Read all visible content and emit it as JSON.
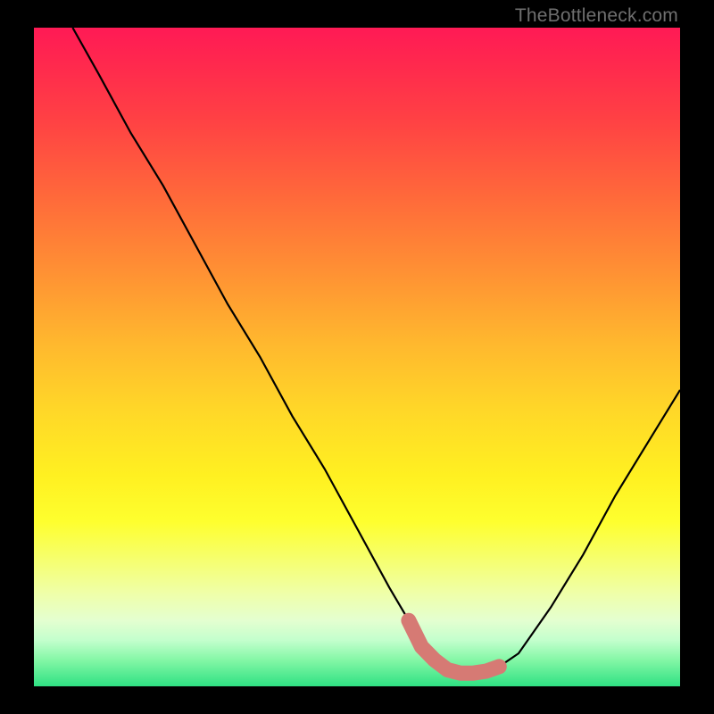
{
  "watermark": "TheBottleneck.com",
  "colors": {
    "curve": "#000000",
    "highlight": "#d67a74",
    "gradient_top": "#ff1a55",
    "gradient_bottom": "#2fe183"
  },
  "chart_data": {
    "type": "line",
    "title": "",
    "xlabel": "",
    "ylabel": "",
    "xlim": [
      0,
      100
    ],
    "ylim": [
      0,
      100
    ],
    "series": [
      {
        "name": "bottleneck-curve",
        "x": [
          6,
          10,
          15,
          20,
          25,
          30,
          35,
          40,
          45,
          50,
          55,
          58,
          60,
          62,
          64,
          66,
          68,
          70,
          72,
          75,
          80,
          85,
          90,
          95,
          100
        ],
        "y": [
          100,
          93,
          84,
          76,
          67,
          58,
          50,
          41,
          33,
          24,
          15,
          10,
          6,
          4,
          2.5,
          2,
          2,
          2.3,
          3,
          5,
          12,
          20,
          29,
          37,
          45
        ]
      }
    ],
    "annotations": [
      {
        "name": "optimal-range-highlight",
        "x": [
          58,
          60,
          62,
          64,
          66,
          68,
          70,
          72
        ],
        "y": [
          10,
          6,
          4,
          2.5,
          2,
          2,
          2.3,
          3
        ]
      }
    ]
  }
}
